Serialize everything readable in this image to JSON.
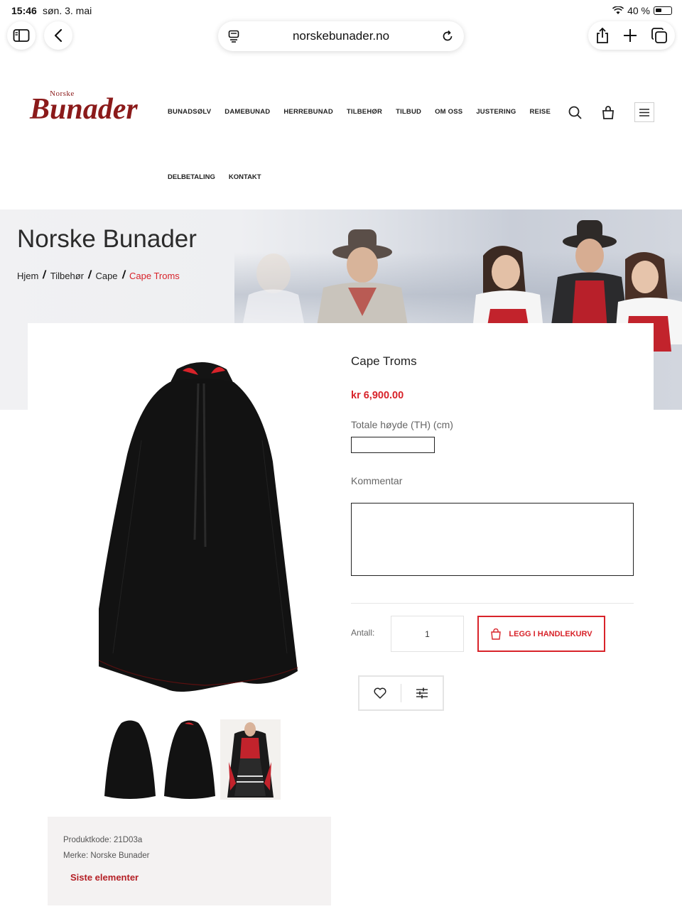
{
  "status_bar": {
    "time": "15:46",
    "date": "søn. 3. mai",
    "battery": "40 %"
  },
  "browser": {
    "url": "norskebunader.no"
  },
  "logo": {
    "small": "Norske",
    "big": "Bunader"
  },
  "nav": {
    "row1": [
      "BUNADSØLV",
      "DAMEBUNAD",
      "HERREBUNAD",
      "TILBEHØR",
      "TILBUD",
      "OM OSS",
      "JUSTERING",
      "REISE"
    ],
    "row2": [
      "DELBETALING",
      "KONTAKT"
    ]
  },
  "hero": {
    "title": "Norske Bunader",
    "breadcrumb": [
      "Hjem",
      "Tilbehør",
      "Cape",
      "Cape Troms"
    ]
  },
  "product": {
    "title": "Cape Troms",
    "price": "kr 6,900.00",
    "height_label": "Totale høyde (TH) (cm)",
    "height_value": "",
    "comment_label": "Kommentar",
    "comment_value": "",
    "qty_label": "Antall:",
    "qty_value": "1",
    "add_to_cart": "LEGG I HANDLEKURV"
  },
  "info": {
    "code": "Produktkode: 21D03a",
    "brand": "Merke: Norske Bunader",
    "stock": "Siste elementer"
  },
  "colors": {
    "accent": "#d8232a",
    "brand": "#8b1a1a"
  }
}
